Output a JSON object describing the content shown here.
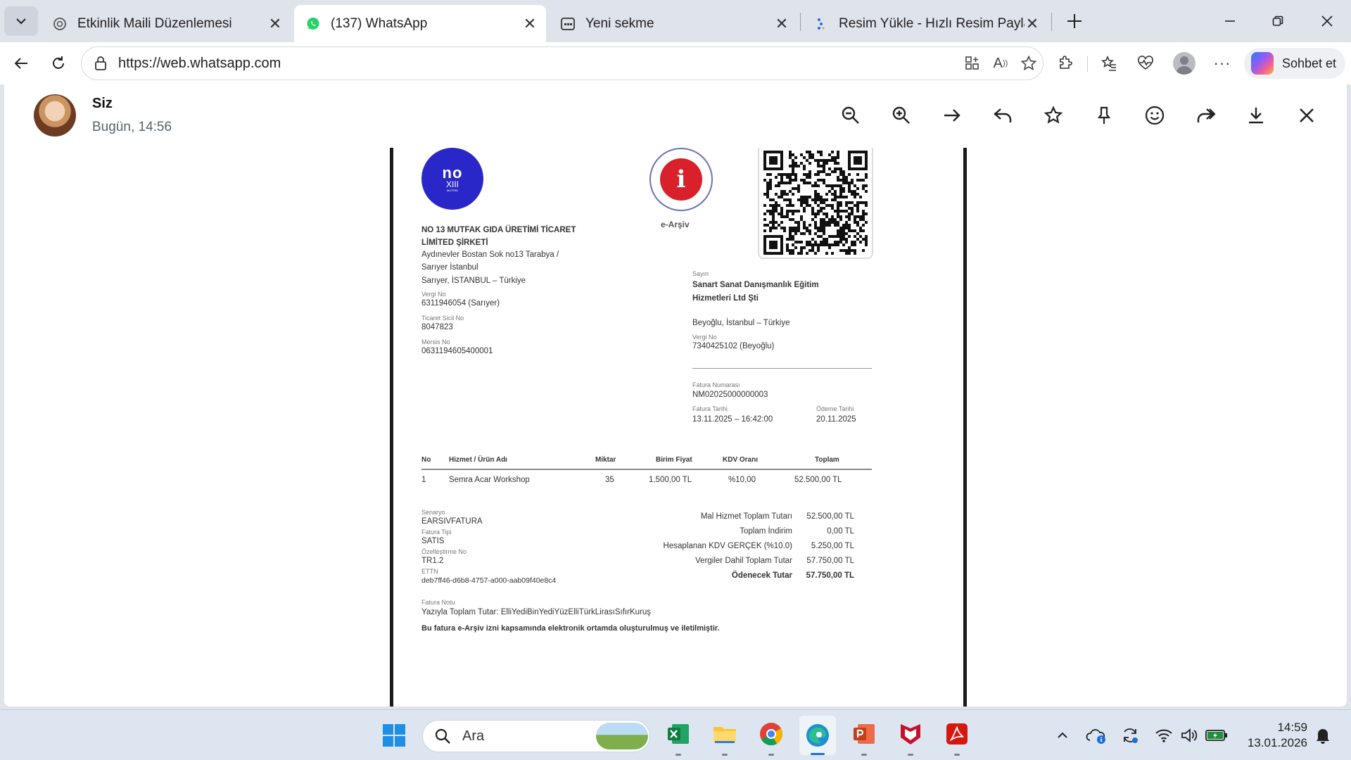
{
  "browser": {
    "tabs": [
      {
        "title": "Etkinlik Maili Düzenlemesi",
        "icon": "chatgpt-icon"
      },
      {
        "title": "(137) WhatsApp",
        "icon": "whatsapp-icon",
        "active": true
      },
      {
        "title": "Yeni sekme",
        "icon": "newtab-icon"
      },
      {
        "title": "Resim Yükle - Hızlı Resim Paylaş - İ",
        "icon": "upload-site-icon"
      }
    ],
    "url": "https://web.whatsapp.com",
    "copilot_label": "Sohbet et"
  },
  "viewer": {
    "sender": "Siz",
    "timestamp": "Bugün, 14:56"
  },
  "invoice": {
    "seller": {
      "logo_text": "no",
      "logo_sub": "XIII",
      "logo_tiny": "MUTFAK",
      "name_line1": "NO 13 MUTFAK GIDA ÜRETİMİ TİCARET",
      "name_line2": "LİMİTED ŞİRKETİ",
      "address1": "Aydınevler Bostan Sok no13 Tarabya /",
      "address2": "Sarıyer İstanbul",
      "address3": "Sarıyer, İSTANBUL – Türkiye",
      "tax_no_label": "Vergi No",
      "tax_no": "6311946054 (Sarıyer)",
      "trade_reg_label": "Ticaret Sicil No",
      "trade_reg": "8047823",
      "mersis_label": "Mersis No",
      "mersis": "0631194605400001"
    },
    "earsiv_label": "e-Arşiv",
    "buyer": {
      "salutation": "Sayın",
      "name_line1": "Sanart Sanat Danışmanlık Eğitim",
      "name_line2": "Hizmetleri Ltd Şti",
      "address": "Beyoğlu, İstanbul – Türkiye",
      "tax_no_label": "Vergi No",
      "tax_no": "7340425102 (Beyoğlu)"
    },
    "meta": {
      "number_label": "Fatura Numarası",
      "number": "NM02025000000003",
      "date_label": "Fatura Tarihi",
      "date": "13.11.2025 – 16:42:00",
      "due_label": "Ödeme Tarihi",
      "due": "20.11.2025"
    },
    "table": {
      "headers": [
        "No",
        "Hizmet / Ürün Adı",
        "Miktar",
        "Birim Fiyat",
        "KDV Oranı",
        "Toplam"
      ],
      "rows": [
        [
          "1",
          "Semra Acar Workshop",
          "35",
          "1.500,00 TL",
          "%10,00",
          "52.500,00 TL"
        ]
      ]
    },
    "details": {
      "scenario_label": "Senaryo",
      "scenario": "EARSIVFATURA",
      "type_label": "Fatura Tipi",
      "type": "SATIS",
      "custom_label": "Özelleştirme No",
      "custom": "TR1.2",
      "ettn_label": "ETTN",
      "ettn": "deb7ff46-d6b8-4757-a000-aab09f40e8c4"
    },
    "totals": [
      {
        "label": "Mal Hizmet Toplam Tutarı",
        "value": "52.500,00 TL"
      },
      {
        "label": "Toplam İndirim",
        "value": "0,00 TL"
      },
      {
        "label": "Hesaplanan KDV GERÇEK (%10.0)",
        "value": "5.250,00 TL"
      },
      {
        "label": "Vergiler Dahil Toplam Tutar",
        "value": "57.750,00 TL"
      },
      {
        "label": "Ödenecek Tutar",
        "value": "57.750,00 TL"
      }
    ],
    "note_label": "Fatura Notu",
    "note": "Yazıyla Toplam Tutar: ElliYediBinYediYüzElliTürkLirasıSıfırKuruş",
    "footer": "Bu fatura e-Arşiv izni kapsamında elektronik ortamda oluşturulmuş ve iletilmiştir."
  },
  "taskbar": {
    "search_placeholder": "Ara",
    "time": "14:59",
    "date": "13.01.2026"
  }
}
